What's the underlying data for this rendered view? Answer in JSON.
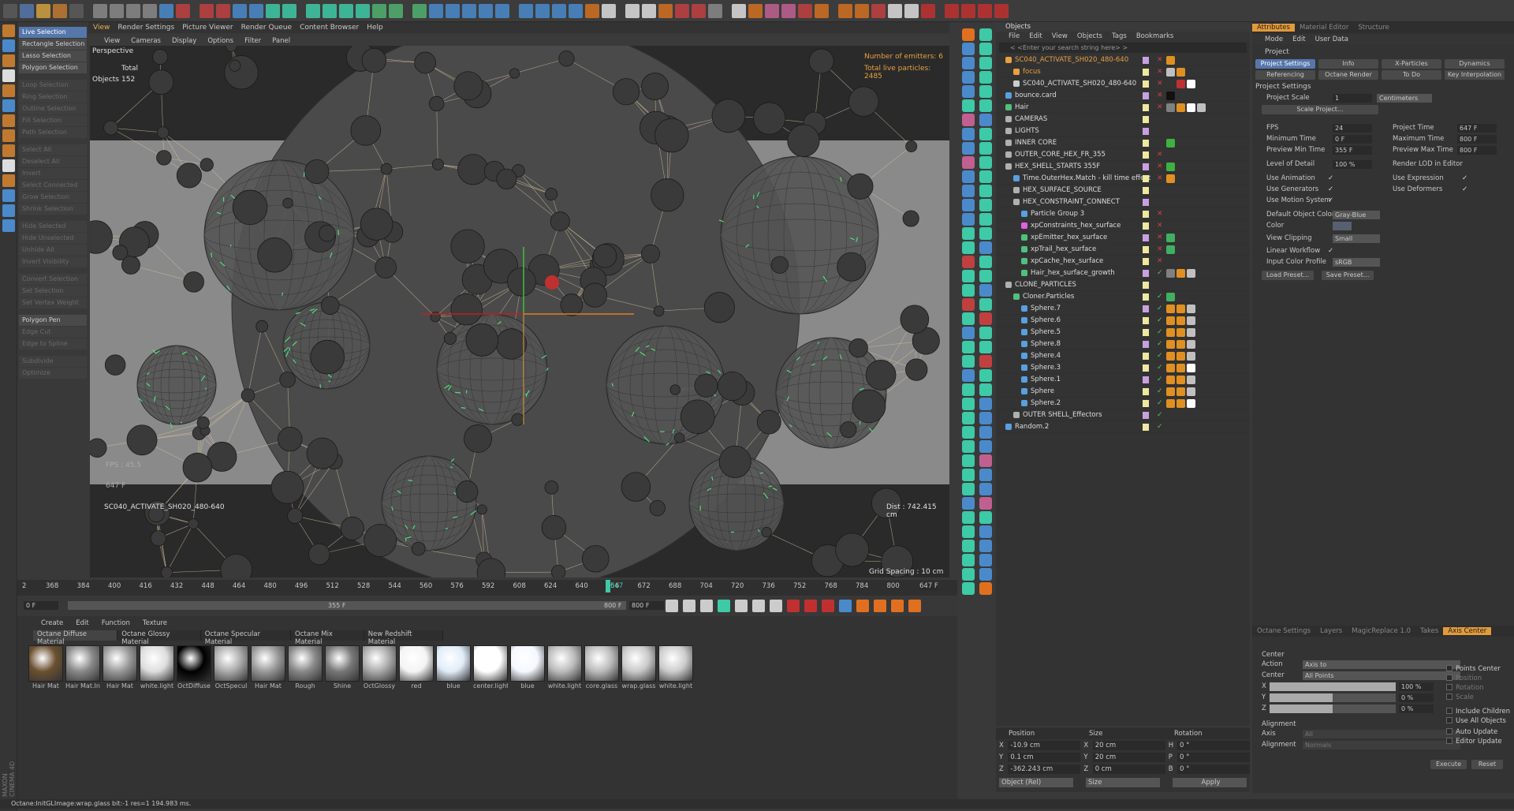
{
  "app": {
    "name": "MAXON CINEMA 4D"
  },
  "viewport": {
    "tabs": [
      "View",
      "Render Settings",
      "Picture Viewer",
      "Render Queue",
      "Content Browser",
      "Help"
    ],
    "menu": [
      "View",
      "Cameras",
      "Display",
      "Options",
      "Filter",
      "Panel"
    ],
    "camera": "Perspective",
    "stats_total": "Total",
    "stats_objects_label": "Objects",
    "stats_objects": "152",
    "emitters": "Number of emitters: 6",
    "particles": "Total live particles: 2485",
    "fps": "FPS : 45.5",
    "frame": "647 F",
    "scene_name": "SC040_ACTIVATE_SH020_480-640",
    "dist": "Dist : 742.415 cm",
    "grid": "Grid Spacing : 10 cm"
  },
  "selection_menu": {
    "groups": [
      [
        {
          "label": "Live Selection",
          "state": "sel"
        },
        {
          "label": "Rectangle Selection",
          "state": "on"
        },
        {
          "label": "Lasso Selection",
          "state": "on"
        },
        {
          "label": "Polygon Selection",
          "state": "on"
        }
      ],
      [
        {
          "label": "Loop Selection",
          "state": "dim"
        },
        {
          "label": "Ring Selection",
          "state": "dim"
        },
        {
          "label": "Outline Selection",
          "state": "dim"
        },
        {
          "label": "Fill Selection",
          "state": "dim"
        },
        {
          "label": "Path Selection",
          "state": "dim"
        }
      ],
      [
        {
          "label": "Select All",
          "state": "dim"
        },
        {
          "label": "Deselect All",
          "state": "dim"
        },
        {
          "label": "Invert",
          "state": "dim"
        },
        {
          "label": "Select Connected",
          "state": "dim"
        },
        {
          "label": "Grow Selection",
          "state": "dim"
        },
        {
          "label": "Shrink Selection",
          "state": "dim"
        }
      ],
      [
        {
          "label": "Hide Selected",
          "state": "dim"
        },
        {
          "label": "Hide Unselected",
          "state": "dim"
        },
        {
          "label": "Unhide All",
          "state": "dim"
        },
        {
          "label": "Invert Visibility",
          "state": "dim"
        }
      ],
      [
        {
          "label": "Convert Selection",
          "state": "dim"
        },
        {
          "label": "Set Selection",
          "state": "dim"
        },
        {
          "label": "Set Vertex Weight",
          "state": "dim"
        }
      ],
      [
        {
          "label": "Polygon Pen",
          "state": "on"
        },
        {
          "label": "Edge Cut",
          "state": "dim"
        },
        {
          "label": "Edge to Spline",
          "state": "dim"
        }
      ],
      [
        {
          "label": "Subdivide",
          "state": "dim"
        },
        {
          "label": "Optimize",
          "state": "dim"
        }
      ]
    ]
  },
  "objects_panel": {
    "title": "Objects",
    "menu": [
      "File",
      "Edit",
      "View",
      "Objects",
      "Tags",
      "Bookmarks"
    ],
    "search_placeholder": "< <Enter your search string here> >",
    "rows": [
      {
        "name": "SC040_ACTIVATE_SH020_480-640",
        "indent": 0,
        "color": "#e8a040",
        "icon": "#e8a040",
        "chk": "x",
        "tags": [
          "#e09020"
        ]
      },
      {
        "name": "focus",
        "indent": 1,
        "color": "#e8a040",
        "icon": "#e8a040",
        "chk": "x",
        "tags": [
          "#c0c0c0",
          "#e09020"
        ]
      },
      {
        "name": "SC040_ACTIVATE_SH020_480-640",
        "indent": 1,
        "color": "#ddd",
        "icon": "#cccccc",
        "chk": "x",
        "tags": [
          "#333",
          "#c03030",
          "#ffffff"
        ]
      },
      {
        "name": "bounce.card",
        "indent": 0,
        "color": "#ddd",
        "icon": "#58a0e0",
        "chk": "x",
        "tags": [
          "#111"
        ]
      },
      {
        "name": "Hair",
        "indent": 0,
        "color": "#ddd",
        "icon": "#50c080",
        "chk": "x",
        "tags": [
          "#808080",
          "#e09020",
          "#ffffff",
          "#c0c0c0"
        ]
      },
      {
        "name": "CAMERAS",
        "indent": 0,
        "color": "#ddd",
        "icon": "#b0b0b0",
        "chk": "",
        "tags": []
      },
      {
        "name": "LIGHTS",
        "indent": 0,
        "color": "#ddd",
        "icon": "#b0b0b0",
        "chk": "",
        "tags": []
      },
      {
        "name": "INNER CORE",
        "indent": 0,
        "color": "#ddd",
        "icon": "#b0b0b0",
        "chk": "",
        "tags": [
          "#40b040"
        ]
      },
      {
        "name": "OUTER_CORE_HEX_FR_355",
        "indent": 0,
        "color": "#ddd",
        "icon": "#b0b0b0",
        "chk": "x",
        "tags": []
      },
      {
        "name": "HEX_SHELL_STARTS 355F",
        "indent": 0,
        "color": "#ddd",
        "icon": "#b0b0b0",
        "chk": "x",
        "tags": [
          "#40b040"
        ]
      },
      {
        "name": "Time.OuterHex.Match - kill time effect",
        "indent": 1,
        "color": "#ddd",
        "icon": "#58a0e0",
        "chk": "x",
        "tags": [
          "#e09020"
        ]
      },
      {
        "name": "HEX_SURFACE_SOURCE",
        "indent": 1,
        "color": "#ddd",
        "icon": "#b0b0b0",
        "chk": "",
        "tags": []
      },
      {
        "name": "HEX_CONSTRAINT_CONNECT",
        "indent": 1,
        "color": "#ddd",
        "icon": "#b0b0b0",
        "chk": "",
        "tags": []
      },
      {
        "name": "Particle Group 3",
        "indent": 2,
        "color": "#ddd",
        "icon": "#58a0e0",
        "chk": "x",
        "tags": []
      },
      {
        "name": "xpConstraints_hex_surface",
        "indent": 2,
        "color": "#ddd",
        "icon": "#e060e0",
        "chk": "x",
        "tags": []
      },
      {
        "name": "xpEmitter_hex_surface",
        "indent": 2,
        "color": "#ddd",
        "icon": "#50c080",
        "chk": "x",
        "tags": [
          "#40b060"
        ]
      },
      {
        "name": "xpTrail_hex_surface",
        "indent": 2,
        "color": "#ddd",
        "icon": "#50c080",
        "chk": "x",
        "tags": [
          "#40b060"
        ]
      },
      {
        "name": "xpCache_hex_surface",
        "indent": 2,
        "color": "#ddd",
        "icon": "#50c080",
        "chk": "x",
        "tags": []
      },
      {
        "name": "Hair_hex_surface_growth",
        "indent": 2,
        "color": "#ddd",
        "icon": "#50c080",
        "chk": "v",
        "tags": [
          "#808080",
          "#e09020",
          "#c0c0c0"
        ]
      },
      {
        "name": "CLONE_PARTICLES",
        "indent": 0,
        "color": "#ddd",
        "icon": "#b0b0b0",
        "chk": "",
        "tags": []
      },
      {
        "name": "Cloner.Particles",
        "indent": 1,
        "color": "#ddd",
        "icon": "#50c080",
        "chk": "v",
        "tags": [
          "#40b060"
        ]
      },
      {
        "name": "Sphere.7",
        "indent": 2,
        "color": "#ddd",
        "icon": "#58a0e0",
        "chk": "v",
        "tags": [
          "#e09020",
          "#e09020",
          "#c0c0c0"
        ]
      },
      {
        "name": "Sphere.6",
        "indent": 2,
        "color": "#ddd",
        "icon": "#58a0e0",
        "chk": "v",
        "tags": [
          "#e09020",
          "#e09020",
          "#c0c0c0"
        ]
      },
      {
        "name": "Sphere.5",
        "indent": 2,
        "color": "#ddd",
        "icon": "#58a0e0",
        "chk": "v",
        "tags": [
          "#e09020",
          "#e09020",
          "#c0c0c0"
        ]
      },
      {
        "name": "Sphere.8",
        "indent": 2,
        "color": "#ddd",
        "icon": "#58a0e0",
        "chk": "v",
        "tags": [
          "#e09020",
          "#e09020",
          "#c0c0c0"
        ]
      },
      {
        "name": "Sphere.4",
        "indent": 2,
        "color": "#ddd",
        "icon": "#58a0e0",
        "chk": "v",
        "tags": [
          "#e09020",
          "#e09020",
          "#c0c0c0"
        ]
      },
      {
        "name": "Sphere.3",
        "indent": 2,
        "color": "#ddd",
        "icon": "#58a0e0",
        "chk": "v",
        "tags": [
          "#e09020",
          "#e09020",
          "#ffffff"
        ]
      },
      {
        "name": "Sphere.1",
        "indent": 2,
        "color": "#ddd",
        "icon": "#58a0e0",
        "chk": "v",
        "tags": [
          "#e09020",
          "#e09020",
          "#c0c0c0"
        ]
      },
      {
        "name": "Sphere",
        "indent": 2,
        "color": "#ddd",
        "icon": "#58a0e0",
        "chk": "v",
        "tags": [
          "#e09020",
          "#e09020",
          "#c0c0c0"
        ]
      },
      {
        "name": "Sphere.2",
        "indent": 2,
        "color": "#ddd",
        "icon": "#58a0e0",
        "chk": "v",
        "tags": [
          "#e09020",
          "#e09020",
          "#ffffff"
        ]
      },
      {
        "name": "OUTER SHELL_Effectors",
        "indent": 1,
        "color": "#ddd",
        "icon": "#b0b0b0",
        "chk": "v",
        "tags": []
      },
      {
        "name": "Random.2",
        "indent": 0,
        "color": "#ddd",
        "icon": "#58a0e0",
        "chk": "v",
        "tags": []
      }
    ]
  },
  "coords": {
    "headers": [
      "Position",
      "Size",
      "Rotation"
    ],
    "rows": [
      {
        "a": "X",
        "av": "-10.9 cm",
        "b": "X",
        "bv": "20 cm",
        "c": "H",
        "cv": "0 °"
      },
      {
        "a": "Y",
        "av": "0.1 cm",
        "b": "Y",
        "bv": "20 cm",
        "c": "P",
        "cv": "0 °"
      },
      {
        "a": "Z",
        "av": "-362.243 cm",
        "b": "Z",
        "bv": "0 cm",
        "c": "B",
        "cv": "0 °"
      }
    ],
    "mode": "Object (Rel)",
    "size_mode": "Size",
    "apply": "Apply"
  },
  "attributes": {
    "tabs": [
      "Attributes",
      "Material Editor",
      "Structure"
    ],
    "menu": [
      "Mode",
      "Edit",
      "User Data"
    ],
    "object": "Project",
    "subtabs_row1": [
      "Project Settings",
      "Info",
      "X-Particles",
      "Dynamics"
    ],
    "subtabs_row2": [
      "Referencing",
      "Octane Render",
      "To Do",
      "Key Interpolation"
    ],
    "section": "Project Settings",
    "project_scale_label": "Project Scale",
    "project_scale": "1",
    "project_scale_unit": "Centimeters",
    "scale_project_btn": "Scale Project...",
    "fps_label": "FPS",
    "fps": "24",
    "project_time_label": "Project Time",
    "project_time": "647 F",
    "min_time_label": "Minimum Time",
    "min_time": "0 F",
    "max_time_label": "Maximum Time",
    "max_time": "800 F",
    "prev_min_label": "Preview Min Time",
    "prev_min": "355 F",
    "prev_max_label": "Preview Max Time",
    "prev_max": "800 F",
    "lod_label": "Level of Detail",
    "lod": "100 %",
    "render_lod_label": "Render LOD in Editor",
    "use_animation": "Use Animation",
    "use_expression": "Use Expression",
    "use_generators": "Use Generators",
    "use_deformers": "Use Deformers",
    "use_motion": "Use Motion System",
    "def_color_label": "Default Object Color",
    "def_color": "Gray-Blue",
    "color_label": "Color",
    "view_clip_label": "View Clipping",
    "view_clip": "Small",
    "linear_label": "Linear Workflow",
    "input_profile_label": "Input Color Profile",
    "input_profile": "sRGB",
    "load_preset": "Load Preset...",
    "save_preset": "Save Preset..."
  },
  "axis": {
    "tabs": [
      "Octane Settings",
      "Layers",
      "MagicReplace 1.0",
      "Takes",
      "Axis Center"
    ],
    "center": "Center",
    "action_label": "Action",
    "action": "Axis to",
    "center_label": "Center",
    "center_val": "All Points",
    "x": "X",
    "xv": "100 %",
    "y": "Y",
    "yv": "0 %",
    "z": "Z",
    "zv": "0 %",
    "x_level": 1.0,
    "y_level": 0.5,
    "z_level": 0.5,
    "alignment": "Alignment",
    "axis_label": "Axis",
    "axis_val": "All",
    "align_label": "Alignment",
    "align_val": "Normals",
    "points_center": "Points Center",
    "position": "Position",
    "rotation": "Rotation",
    "scale": "Scale",
    "include_children": "Include Children",
    "use_all_objects": "Use All Objects",
    "auto_update": "Auto Update",
    "editor_update": "Editor Update",
    "execute": "Execute",
    "reset": "Reset"
  },
  "timeline": {
    "ticks": [
      "368",
      "384",
      "400",
      "416",
      "432",
      "448",
      "464",
      "480",
      "496",
      "512",
      "528",
      "544",
      "560",
      "576",
      "592",
      "608",
      "624",
      "640",
      "656",
      "672",
      "688",
      "704",
      "720",
      "736",
      "752",
      "768",
      "784",
      "800"
    ],
    "first_tick": "2",
    "current": "647",
    "end": "647 F",
    "start_field": "0 F",
    "range_start": "355 F",
    "range_end": "800 F",
    "end_field": "800 F"
  },
  "materials": {
    "menu": [
      "Create",
      "Edit",
      "Function",
      "Texture"
    ],
    "types": [
      "Octane Diffuse Material",
      "Octane Glossy Material",
      "Octane Specular Material",
      "Octane Mix Material",
      "New Redshift Material"
    ],
    "items": [
      {
        "label": "Hair Mat",
        "fill": "#6b5030"
      },
      {
        "label": "Hair Mat.In",
        "fill": "#888"
      },
      {
        "label": "Hair Mat",
        "fill": "#999"
      },
      {
        "label": "white.light",
        "fill": "#ddd"
      },
      {
        "label": "OctDiffuse",
        "fill": "#000"
      },
      {
        "label": "OctSpecul",
        "fill": "#aaa"
      },
      {
        "label": "Hair Mat",
        "fill": "#999"
      },
      {
        "label": "Rough",
        "fill": "#888"
      },
      {
        "label": "Shine",
        "fill": "#777"
      },
      {
        "label": "OctGlossy",
        "fill": "#aaa"
      },
      {
        "label": "red",
        "fill": "#f4f4f4"
      },
      {
        "label": "blue",
        "fill": "#e0ecf8"
      },
      {
        "label": "center.light",
        "fill": "#ffffff"
      },
      {
        "label": "blue",
        "fill": "#f4f8ff"
      },
      {
        "label": "white.light",
        "fill": "#bbb"
      },
      {
        "label": "core.glass",
        "fill": "#bbb"
      },
      {
        "label": "wrap.glass",
        "fill": "#c8c8c8"
      },
      {
        "label": "white.light",
        "fill": "#ccc"
      }
    ]
  },
  "status": "Octane:InitGLImage:wrap.glass  bit:-1 res=1 194.983 ms.",
  "colors": {
    "accent": "#e29a3a",
    "select": "#5577aa",
    "teal": "#3ec9a7",
    "green_line": "#4de07a"
  }
}
